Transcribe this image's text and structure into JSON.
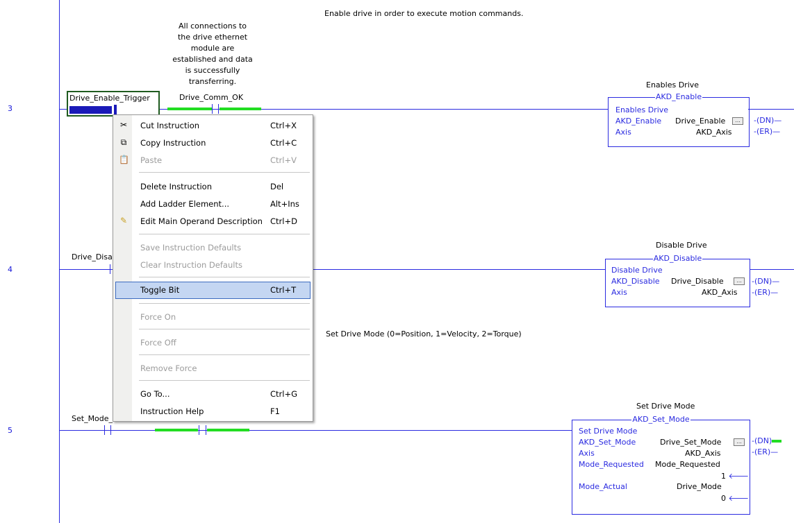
{
  "rungs": [
    {
      "number": "3"
    },
    {
      "number": "4"
    },
    {
      "number": "5"
    }
  ],
  "rung3": {
    "comment_top": "Enable drive in order to execute motion commands.",
    "contact1_tag": "Drive_Enable_Trigger",
    "contact2_comment": [
      "All connections to",
      "the drive ethernet",
      "module are",
      "established and data",
      "is successfully",
      "transferring."
    ],
    "contact2_tag": "Drive_Comm_OK",
    "block_desc": "Enables Drive",
    "block_name": "AKD_Enable",
    "block_subtitle": "Enables Drive",
    "row1_label": "AKD_Enable",
    "row1_value": "Drive_Enable",
    "row2_label": "Axis",
    "row2_value": "AKD_Axis",
    "coil_dn": "DN",
    "coil_er": "ER",
    "ellipsis": "..."
  },
  "rung4": {
    "contact1_tag": "Drive_Disa",
    "block_desc": "Disable Drive",
    "block_name": "AKD_Disable",
    "block_subtitle": "Disable Drive",
    "row1_label": "AKD_Disable",
    "row1_value": "Drive_Disable",
    "row2_label": "Axis",
    "row2_value": "AKD_Axis",
    "coil_dn": "DN",
    "coil_er": "ER",
    "ellipsis": "..."
  },
  "rung5": {
    "comment_top": "Set Drive Mode (0=Position, 1=Velocity, 2=Torque)",
    "contact1_tag": "Set_Mode_",
    "block_desc": "Set Drive Mode",
    "block_name": "AKD_Set_Mode",
    "block_subtitle": "Set Drive Mode",
    "row1_label": "AKD_Set_Mode",
    "row1_value": "Drive_Set_Mode",
    "row2_label": "Axis",
    "row2_value": "AKD_Axis",
    "row3_label": "Mode_Requested",
    "row3_value": "Mode_Requested",
    "row3_num": "1",
    "row4_label": "Mode_Actual",
    "row4_value": "Drive_Mode",
    "row4_num": "0",
    "coil_dn": "DN",
    "coil_er": "ER",
    "ellipsis": "..."
  },
  "context_menu": {
    "items": [
      {
        "label": "Cut Instruction",
        "shortcut": "Ctrl+X",
        "icon": "scissors-icon",
        "disabled": false
      },
      {
        "label": "Copy Instruction",
        "shortcut": "Ctrl+C",
        "icon": "copy-icon",
        "disabled": false
      },
      {
        "label": "Paste",
        "shortcut": "Ctrl+V",
        "icon": "paste-icon",
        "disabled": true
      },
      {
        "label": "Delete Instruction",
        "shortcut": "Del",
        "disabled": false
      },
      {
        "label": "Add Ladder Element...",
        "shortcut": "Alt+Ins",
        "disabled": false
      },
      {
        "label": "Edit Main Operand Description",
        "shortcut": "Ctrl+D",
        "icon": "pencil-icon",
        "disabled": false
      },
      {
        "label": "Save Instruction Defaults",
        "shortcut": "",
        "disabled": true
      },
      {
        "label": "Clear Instruction Defaults",
        "shortcut": "",
        "disabled": true
      },
      {
        "label": "Toggle Bit",
        "shortcut": "Ctrl+T",
        "disabled": false,
        "highlighted": true
      },
      {
        "label": "Force On",
        "shortcut": "",
        "disabled": true
      },
      {
        "label": "Force Off",
        "shortcut": "",
        "disabled": true
      },
      {
        "label": "Remove Force",
        "shortcut": "",
        "disabled": true
      },
      {
        "label": "Go To...",
        "shortcut": "Ctrl+G",
        "disabled": false
      },
      {
        "label": "Instruction Help",
        "shortcut": "F1",
        "disabled": false
      }
    ]
  },
  "colors": {
    "wire": "#2a2ae0",
    "energized": "#22dd22",
    "highlight": "#c4d6f2"
  }
}
